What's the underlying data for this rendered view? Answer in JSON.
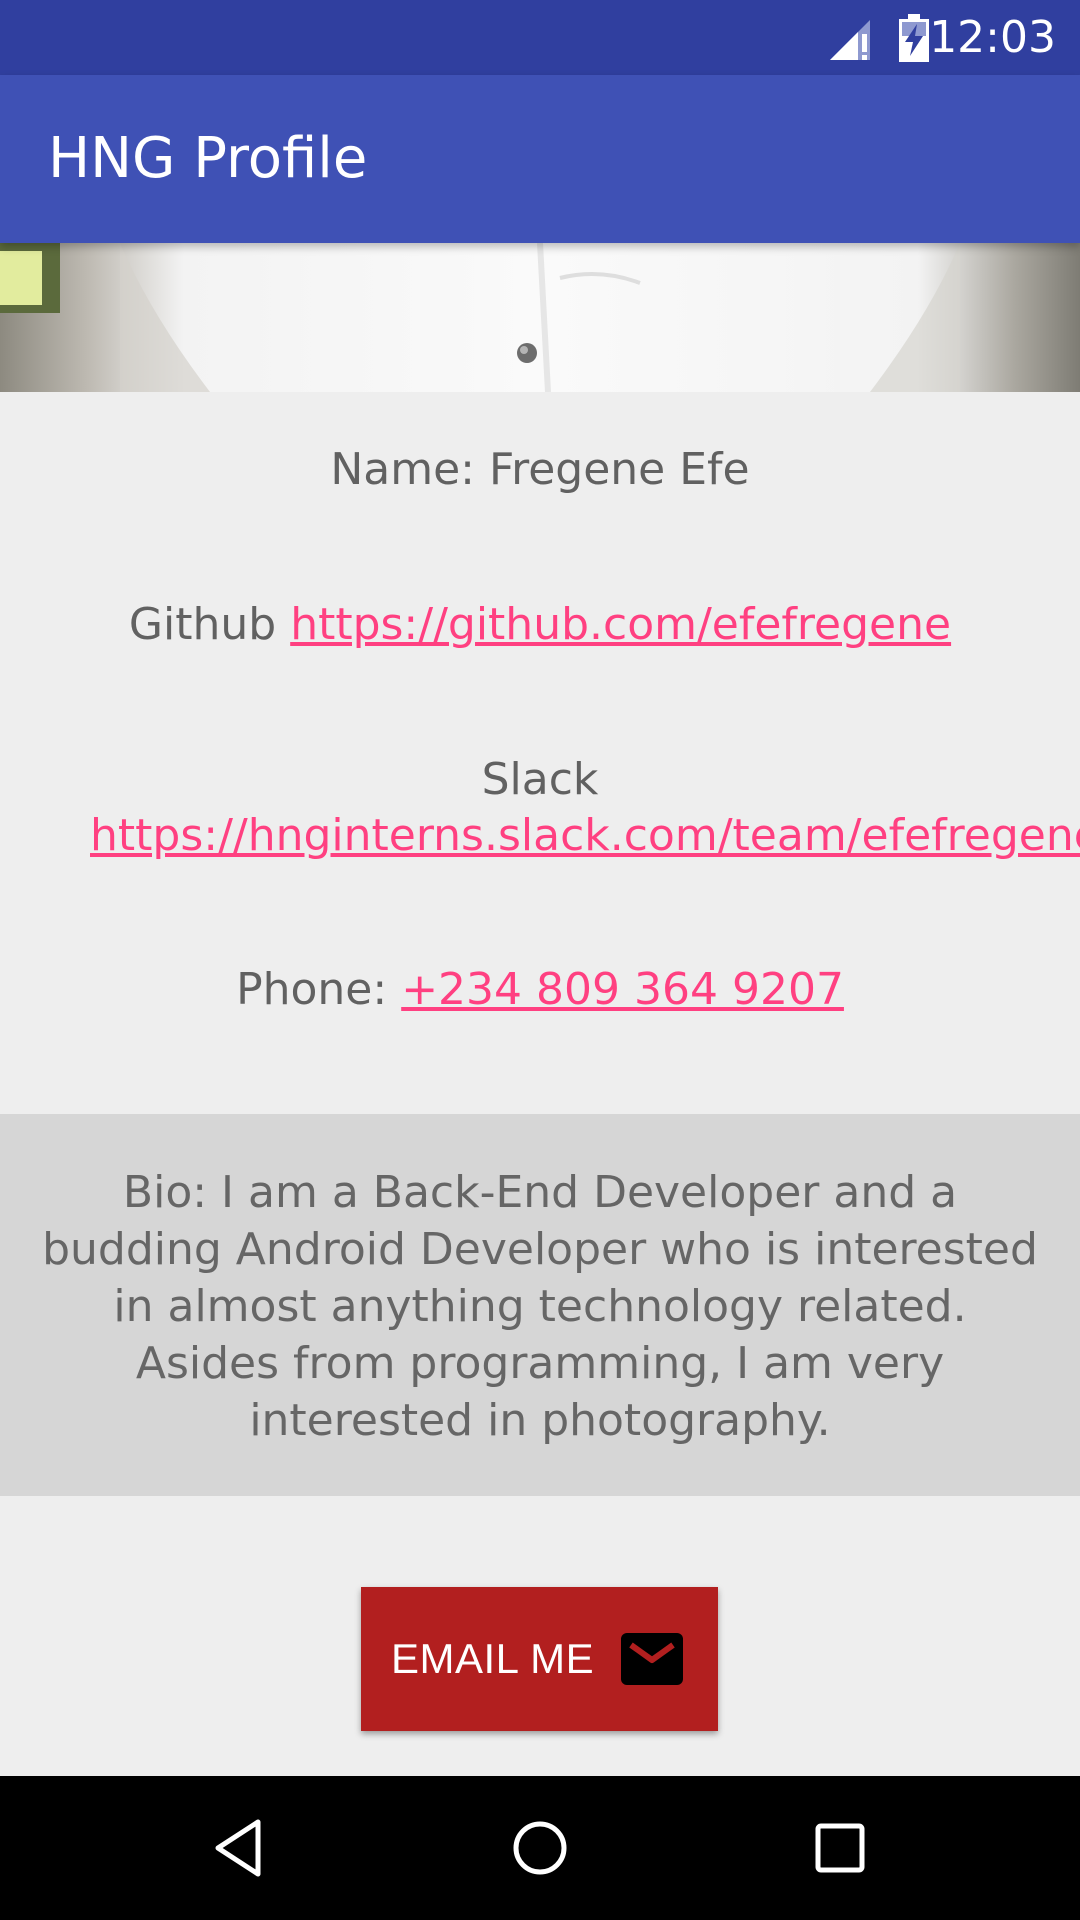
{
  "status_bar": {
    "time": "12:03",
    "icons": [
      "signal-alert-icon",
      "battery-charging-icon"
    ]
  },
  "app_bar": {
    "title": "HNG Profile"
  },
  "profile": {
    "name_label": "Name: Fregene Efe",
    "github_label": "Github",
    "github_link": "https://github.com/efefregene",
    "slack_label": "Slack",
    "slack_link": "https://hnginterns.slack.com/team/efefregene",
    "phone_label": "Phone:",
    "phone_link": "+234 809 364 9207",
    "bio": "Bio: I am a Back-End Developer and a budding Android Developer who is interested in almost anything technology related. Asides from programming, I am very interested in photography."
  },
  "email_button": {
    "label": "EMAIL ME",
    "icon": "mail-icon"
  },
  "nav_bar": {
    "icons": [
      "back-icon",
      "home-icon",
      "recents-icon"
    ]
  },
  "colors": {
    "status_bar": "#303f9f",
    "app_bar": "#3f51b5",
    "link": "#ff4081",
    "button": "#b21f1f",
    "bio_background": "#d6d6d6"
  }
}
